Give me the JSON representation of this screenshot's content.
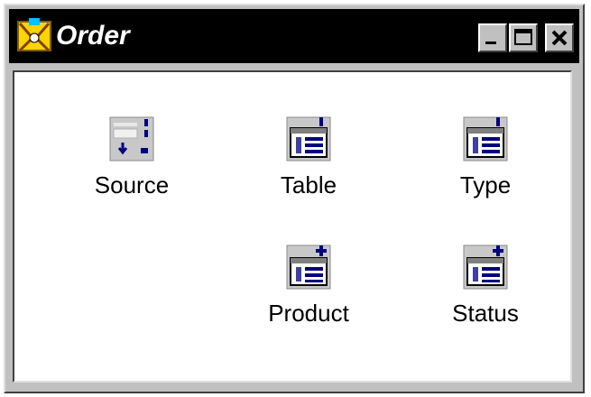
{
  "window": {
    "title": "Order",
    "title_bar_color": "#000000",
    "title_text_color": "#ffffff",
    "controls": {
      "minimize": "minimize-icon",
      "maximize": "maximize-icon",
      "close": "close-icon"
    }
  },
  "items": [
    {
      "label": "Source",
      "icon": "source-query-icon"
    },
    {
      "label": "Table",
      "icon": "table-icon"
    },
    {
      "label": "Type",
      "icon": "table-icon"
    },
    {
      "label": "Product",
      "icon": "table-add-icon"
    },
    {
      "label": "Status",
      "icon": "table-add-icon"
    }
  ]
}
